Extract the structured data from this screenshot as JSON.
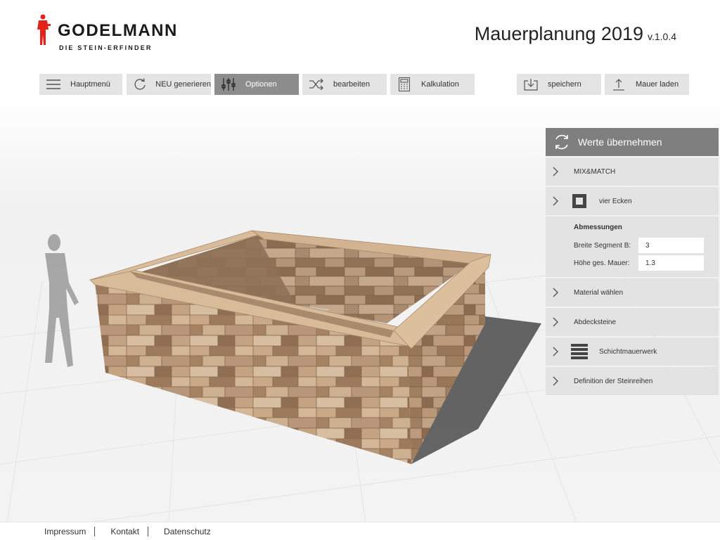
{
  "brand": {
    "name": "GODELMANN",
    "tagline": "DIE STEIN-ERFINDER"
  },
  "app": {
    "title": "Mauerplanung 2019",
    "version": "v.1.0.4"
  },
  "toolbar": {
    "main_menu": "Hauptmenü",
    "regenerate": "NEU generieren",
    "options": "Optionen",
    "edit": "bearbeiten",
    "calculation": "Kalkulation",
    "save": "speichern",
    "load": "Mauer laden",
    "active_item": "Optionen"
  },
  "panel": {
    "apply_label": "Werte übernehmen",
    "mix_match": "MIX&MATCH",
    "corners": "vier Ecken",
    "dimensions": {
      "title": "Abmessungen",
      "segment_label": "Breite Segment B:",
      "segment_value": "3",
      "height_label": "Höhe ges. Mauer:",
      "height_value": "1.3"
    },
    "material": "Material wählen",
    "coping": "Abdecksteine",
    "layered": "Schichtmauerwerk",
    "rows": "Definition der Steinreihen"
  },
  "footer": {
    "imprint": "Impressum",
    "contact": "Kontakt",
    "privacy": "Datenschutz"
  },
  "colors": {
    "brand_red": "#e2231a",
    "toolbar_bg": "#e4e4e4",
    "toolbar_active": "#8d8d8d",
    "panel_header": "#7f7f7f",
    "panel_row": "#e3e3e3"
  }
}
